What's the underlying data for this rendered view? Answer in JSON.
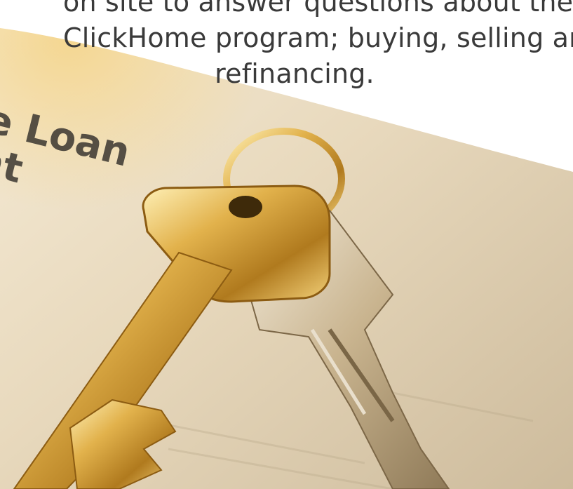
{
  "caption": {
    "lines": [
      "on site to answer questions about the",
      "ClickHome program; buying, selling and",
      "refinancing."
    ]
  },
  "document_text": {
    "lines": [
      "e Loan",
      "nt"
    ]
  },
  "colors": {
    "caption_text": "#3a3a3a",
    "paper": "#e9dcc4",
    "gold": "#d9a441",
    "silver": "#c8b89a"
  }
}
